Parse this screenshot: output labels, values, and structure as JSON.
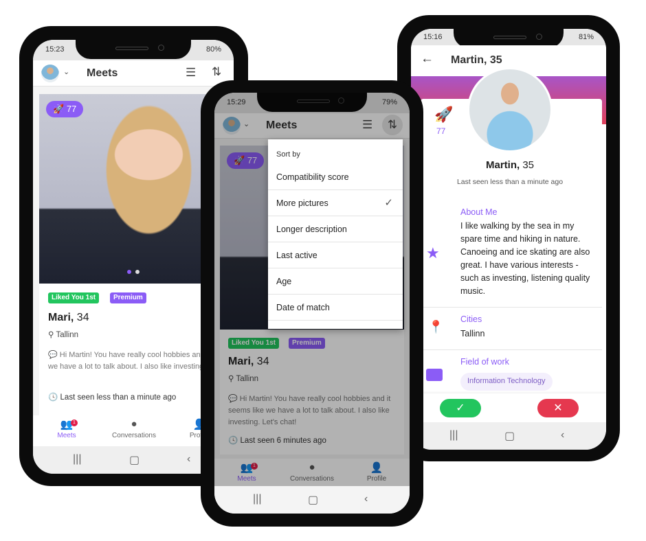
{
  "colors": {
    "accent": "#8b5cf6",
    "liked": "#22c55e",
    "accept": "#22c55e",
    "reject": "#e5384f",
    "badge": "#e11d48"
  },
  "phone_left": {
    "status": {
      "time": "15:23",
      "battery": "80%"
    },
    "appbar": {
      "title": "Meets",
      "icons": [
        "filter-icon",
        "sort-icon"
      ]
    },
    "card": {
      "boost": "77",
      "badges": [
        "Liked You 1st",
        "Premium"
      ],
      "name": "Mari,",
      "age": "34",
      "location": "Tallinn",
      "message": "Hi Martin! You have really cool hobbies and it seems like we have a lot to talk about. I also like investing. Let's chat!",
      "last_seen": "Last seen less than a minute ago"
    },
    "nav": {
      "items": [
        "Meets",
        "Conversations",
        "Profile"
      ],
      "badge": "1"
    }
  },
  "phone_middle": {
    "status": {
      "time": "15:29",
      "battery": "79%"
    },
    "appbar": {
      "title": "Meets"
    },
    "card": {
      "boost": "77",
      "badges": [
        "Liked You 1st",
        "Premium"
      ],
      "name": "Mari,",
      "age": "34",
      "location": "Tallinn",
      "message": "Hi Martin! You have really cool hobbies and it seems like we have a lot to talk about. I also like investing. Let's chat!",
      "last_seen": "Last seen 6 minutes ago"
    },
    "sort_menu": {
      "header": "Sort by",
      "items": [
        "Compatibility score",
        "More pictures",
        "Longer description",
        "Last active",
        "Age",
        "Date of match"
      ],
      "selected": "More pictures"
    },
    "nav": {
      "items": [
        "Meets",
        "Conversations",
        "Profile"
      ],
      "badge": "1"
    }
  },
  "phone_right": {
    "status": {
      "time": "15:16",
      "battery": "81%"
    },
    "appbar": {
      "title": "Martin, 35"
    },
    "profile": {
      "boost": "77",
      "name": "Martin,",
      "age": "35",
      "last_seen": "Last seen less than a minute ago",
      "about_label": "About Me",
      "about_text": "I like walking by the sea in my spare time and hiking in nature. Canoeing and ice skating are also great. I have various interests - such as investing, listening quality music.",
      "cities_label": "Cities",
      "cities": "Tallinn",
      "work_label": "Field of work",
      "work_chip": "Information Technology"
    }
  }
}
